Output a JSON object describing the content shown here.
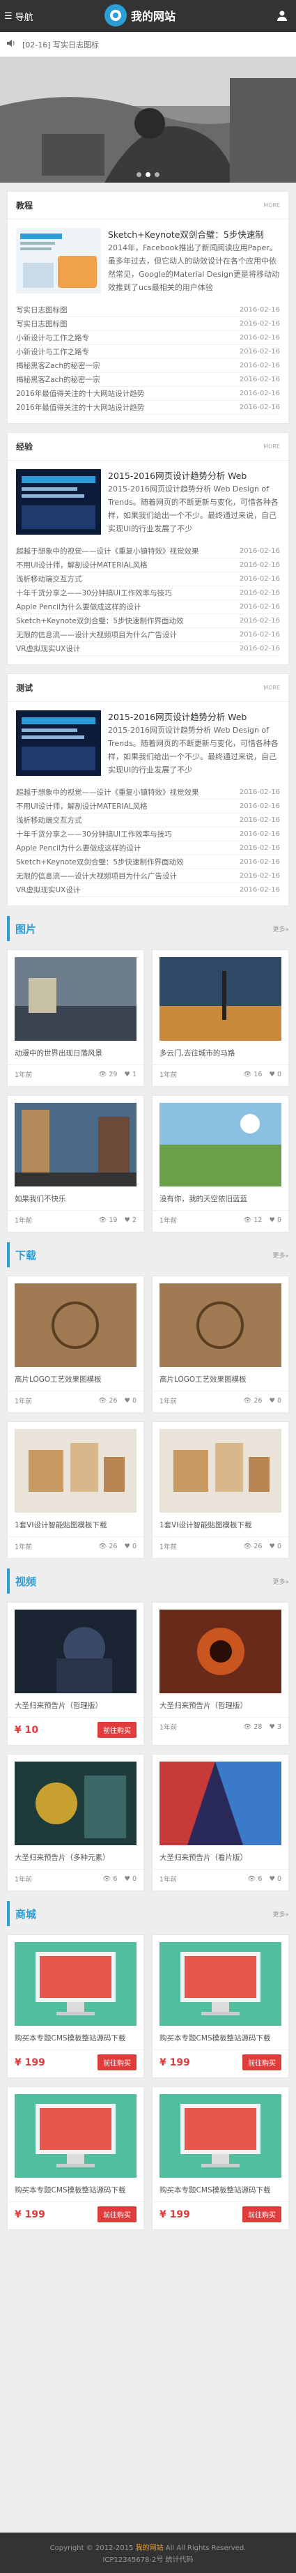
{
  "header": {
    "nav_label": "导航",
    "site_name": "我的网站"
  },
  "notice": {
    "text": "[02-16] 写实日志图标"
  },
  "sections": {
    "tutorial": {
      "title": "教程",
      "more": "MORE",
      "feature": {
        "title": "Sketch+Keynote双剑合璧：5步快速制",
        "body": "2014年，Facebook推出了新闻阅读应用Paper。虽多年过去，但它动人的动效设计在各个应用中依然常见，Google的Material Design更是将移动动效推到了ucs最相关的用户体验"
      },
      "items": [
        {
          "t": "写实日志图标图",
          "d": "2016-02-16"
        },
        {
          "t": "写实日志图标图",
          "d": "2016-02-16"
        },
        {
          "t": "小新设计与工作之路专",
          "d": "2016-02-16"
        },
        {
          "t": "小新设计与工作之路专",
          "d": "2016-02-16"
        },
        {
          "t": "揭秘黑客Zach的秘密一宗",
          "d": "2016-02-16"
        },
        {
          "t": "揭秘黑客Zach的秘密一宗",
          "d": "2016-02-16"
        },
        {
          "t": "2016年最值得关注的十大网站设计趋势",
          "d": "2016-02-16"
        },
        {
          "t": "2016年最值得关注的十大网站设计趋势",
          "d": "2016-02-16"
        }
      ]
    },
    "experience": {
      "title": "经验",
      "more": "MORE",
      "feature": {
        "title": "2015-2016网页设计趋势分析 Web",
        "body": "2015-2016网页设计趋势分析 Web Design of Trends。随着网页的不断更新与变化，可惜各种各样，如果我们给出一个不少。最终通过来说，自己实现UI的行业发展了不少"
      },
      "items": [
        {
          "t": "超越于想象中的视觉——设计《重复小镇特效》视觉效果",
          "d": "2016-02-16"
        },
        {
          "t": "不用UI设计师，解剖设计MATERIAL风格",
          "d": "2016-02-16"
        },
        {
          "t": "浅析移动端交互方式",
          "d": "2016-02-16"
        },
        {
          "t": "十年千货分享之——30分钟搞UI工作效率与技巧",
          "d": "2016-02-16"
        },
        {
          "t": "Apple Pencil为什么要做成这样的设计",
          "d": "2016-02-16"
        },
        {
          "t": "Sketch+Keynote双剑合璧：5步快速制作界面动效",
          "d": "2016-02-16"
        },
        {
          "t": "无限的信息流——设计大视频项目为什么广告设计",
          "d": "2016-02-16"
        },
        {
          "t": "VR虚拟现实UX设计",
          "d": "2016-02-16"
        }
      ]
    },
    "test": {
      "title": "测试",
      "more": "MORE",
      "feature": {
        "title": "2015-2016网页设计趋势分析 Web",
        "body": "2015-2016网页设计趋势分析 Web Design of Trends。随着网页的不断更新与变化，可惜各种各样，如果我们给出一个不少。最终通过来说，自己实现UI的行业发展了不少"
      },
      "items": [
        {
          "t": "超越于想象中的视觉——设计《重复小镇特效》视觉效果",
          "d": "2016-02-16"
        },
        {
          "t": "不用UI设计师，解剖设计MATERIAL风格",
          "d": "2016-02-16"
        },
        {
          "t": "浅析移动端交互方式",
          "d": "2016-02-16"
        },
        {
          "t": "十年千货分享之——30分钟搞UI工作效率与技巧",
          "d": "2016-02-16"
        },
        {
          "t": "Apple Pencil为什么要做成这样的设计",
          "d": "2016-02-16"
        },
        {
          "t": "Sketch+Keynote双剑合璧：5步快速制作界面动效",
          "d": "2016-02-16"
        },
        {
          "t": "无限的信息流——设计大视频项目为什么广告设计",
          "d": "2016-02-16"
        },
        {
          "t": "VR虚拟现实UX设计",
          "d": "2016-02-16"
        }
      ]
    }
  },
  "photos": {
    "title": "图片",
    "more": "更多»",
    "cards": [
      {
        "cap": "动漫中的世界出现日落风景",
        "time": "1年前",
        "views": "29",
        "likes": "1"
      },
      {
        "cap": "多云门,去往城市的马路",
        "time": "1年前",
        "views": "16",
        "likes": "0"
      },
      {
        "cap": "如果我们不快乐",
        "time": "1年前",
        "views": "19",
        "likes": "2"
      },
      {
        "cap": "没有你，我的天空依旧蓝蓝",
        "time": "1年前",
        "views": "12",
        "likes": "0"
      }
    ]
  },
  "downloads": {
    "title": "下载",
    "more": "更多»",
    "cards": [
      {
        "cap": "高片LOGO工艺效果图模板",
        "time": "1年前",
        "views": "26",
        "likes": "0"
      },
      {
        "cap": "高片LOGO工艺效果图模板",
        "time": "1年前",
        "views": "26",
        "likes": "0"
      },
      {
        "cap": "1套VI设计智能贴图模板下载",
        "time": "1年前",
        "views": "26",
        "likes": "0"
      },
      {
        "cap": "1套VI设计智能贴图模板下载",
        "time": "1年前",
        "views": "26",
        "likes": "0"
      }
    ]
  },
  "videos": {
    "title": "视频",
    "more": "更多»",
    "cards": [
      {
        "cap": "大圣归来预告片（哲理版）",
        "price": "¥ 10",
        "btn": "前往购买"
      },
      {
        "cap": "大圣归来预告片（哲理版）",
        "time": "1年前",
        "views": "28",
        "likes": "3"
      },
      {
        "cap": "大圣归来预告片（多种元素）",
        "time": "1年前",
        "views": "6",
        "likes": "0"
      },
      {
        "cap": "大圣归来预告片（看片版）",
        "time": "1年前",
        "views": "6",
        "likes": "0"
      }
    ]
  },
  "shop": {
    "title": "商城",
    "more": "更多»",
    "cards": [
      {
        "cap": "购买本专题CMS模板整站源码下载",
        "price": "¥ 199",
        "btn": "前往购买"
      },
      {
        "cap": "购买本专题CMS模板整站源码下载",
        "price": "¥ 199",
        "btn": "前往购买"
      },
      {
        "cap": "购买本专题CMS模板整站源码下载",
        "price": "¥ 199",
        "btn": "前往购买"
      },
      {
        "cap": "购买本专题CMS模板整站源码下载",
        "price": "¥ 199",
        "btn": "前往购买"
      }
    ]
  },
  "footer": {
    "copyright": "Copyright © 2012-2015",
    "site": "我的网站",
    "rights": "All All Rights Reserved.",
    "icp": "ICP12345678-2号 统计代码"
  },
  "colors": {
    "accent": "#2b9ed8",
    "price": "#e23b3b",
    "dark": "#333333"
  }
}
